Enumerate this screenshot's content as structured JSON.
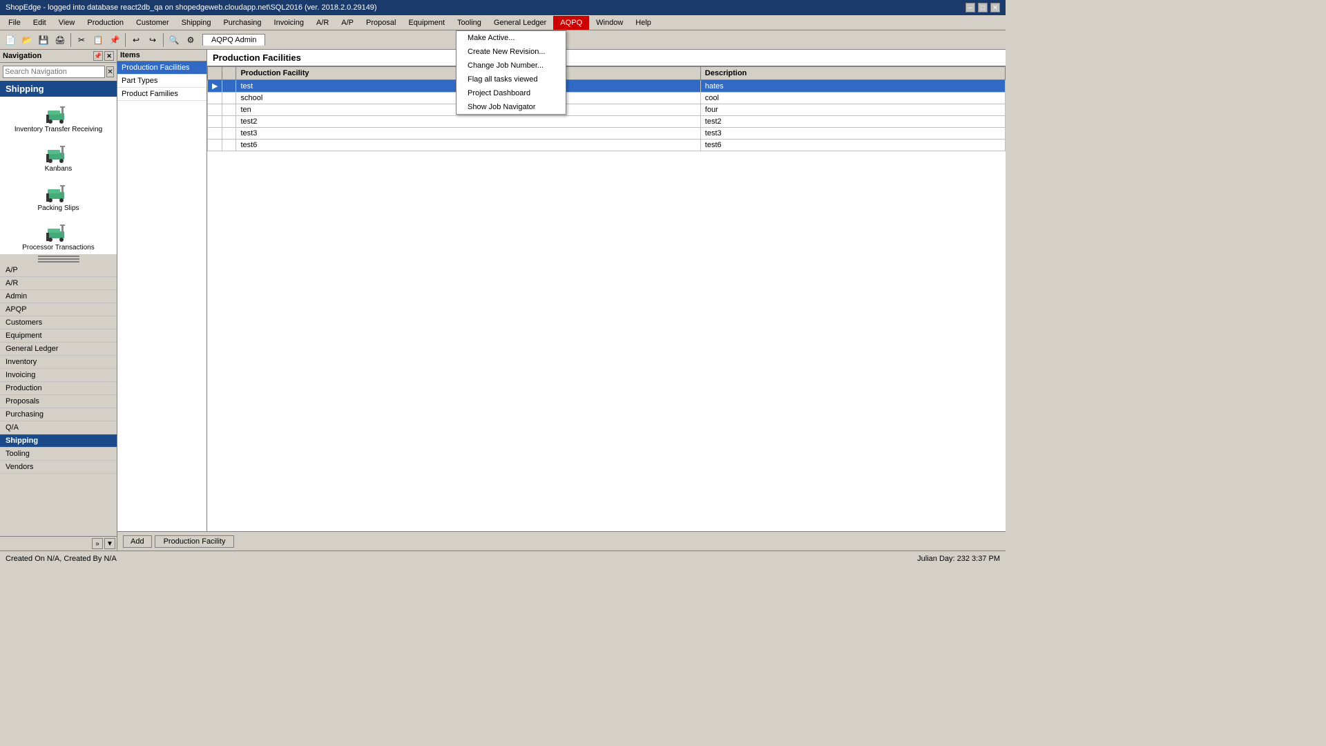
{
  "titleBar": {
    "text": "ShopEdge - logged into database react2db_qa on shopedgeweb.cloudapp.net\\SQL2016 (ver. 2018.2.0.29149)",
    "controls": [
      "minimize",
      "maximize",
      "close"
    ]
  },
  "menuBar": {
    "items": [
      {
        "label": "File",
        "id": "file"
      },
      {
        "label": "Edit",
        "id": "edit"
      },
      {
        "label": "View",
        "id": "view"
      },
      {
        "label": "Production",
        "id": "production"
      },
      {
        "label": "Customer",
        "id": "customer"
      },
      {
        "label": "Shipping",
        "id": "shipping"
      },
      {
        "label": "Purchasing",
        "id": "purchasing"
      },
      {
        "label": "Invoicing",
        "id": "invoicing"
      },
      {
        "label": "A/R",
        "id": "ar"
      },
      {
        "label": "A/P",
        "id": "ap"
      },
      {
        "label": "Proposal",
        "id": "proposal"
      },
      {
        "label": "Equipment",
        "id": "equipment"
      },
      {
        "label": "Tooling",
        "id": "tooling"
      },
      {
        "label": "General Ledger",
        "id": "general-ledger"
      },
      {
        "label": "AQPQ",
        "id": "aqpq",
        "highlighted": true
      },
      {
        "label": "Window",
        "id": "window"
      },
      {
        "label": "Help",
        "id": "help"
      }
    ]
  },
  "toolbar": {
    "activeTab": "AQPQ Admin"
  },
  "navigation": {
    "title": "Navigation",
    "searchPlaceholder": "Search Navigation",
    "activeSection": "Shipping",
    "sections": [
      {
        "label": "A/P"
      },
      {
        "label": "A/R"
      },
      {
        "label": "Admin"
      },
      {
        "label": "APQP"
      },
      {
        "label": "Customers"
      },
      {
        "label": "Equipment"
      },
      {
        "label": "General Ledger"
      },
      {
        "label": "Inventory"
      },
      {
        "label": "Invoicing"
      },
      {
        "label": "Production"
      },
      {
        "label": "Proposals"
      },
      {
        "label": "Purchasing"
      },
      {
        "label": "Q/A"
      },
      {
        "label": "Shipping"
      },
      {
        "label": "Tooling"
      },
      {
        "label": "Vendors"
      }
    ],
    "shippingItems": [
      {
        "label": "Inventory Transfer Receiving",
        "icon": "forklift"
      },
      {
        "label": "Kanbans",
        "icon": "forklift"
      },
      {
        "label": "Packing Slips",
        "icon": "forklift"
      },
      {
        "label": "Processor Transactions",
        "icon": "forklift"
      }
    ]
  },
  "itemsPanel": {
    "header": "Items",
    "items": [
      {
        "label": "Production Facilities",
        "selected": true
      },
      {
        "label": "Part Types"
      },
      {
        "label": "Product Families"
      }
    ]
  },
  "dataPanel": {
    "title": "Production Facilities",
    "columns": [
      "Production Facility",
      "Description"
    ],
    "rows": [
      {
        "facility": "test",
        "description": "hates",
        "selected": true,
        "arrow": true
      },
      {
        "facility": "school",
        "description": "cool",
        "selected": false
      },
      {
        "facility": "ten",
        "description": "four",
        "selected": false
      },
      {
        "facility": "test2",
        "description": "test2",
        "selected": false
      },
      {
        "facility": "test3",
        "description": "test3",
        "selected": false
      },
      {
        "facility": "test6",
        "description": "test6",
        "selected": false
      }
    ]
  },
  "dropdown": {
    "visible": true,
    "items": [
      {
        "label": "Make Active..."
      },
      {
        "label": "Create New Revision..."
      },
      {
        "label": "Change Job Number..."
      },
      {
        "label": "Flag all tasks viewed"
      },
      {
        "label": "Project Dashboard"
      },
      {
        "label": "Show Job Navigator"
      }
    ]
  },
  "bottomBar": {
    "addLabel": "Add",
    "tabLabel": "Production Facility"
  },
  "statusBar": {
    "left": "Created On N/A, Created By N/A",
    "right": "Julian Day: 232    3:37 PM"
  }
}
